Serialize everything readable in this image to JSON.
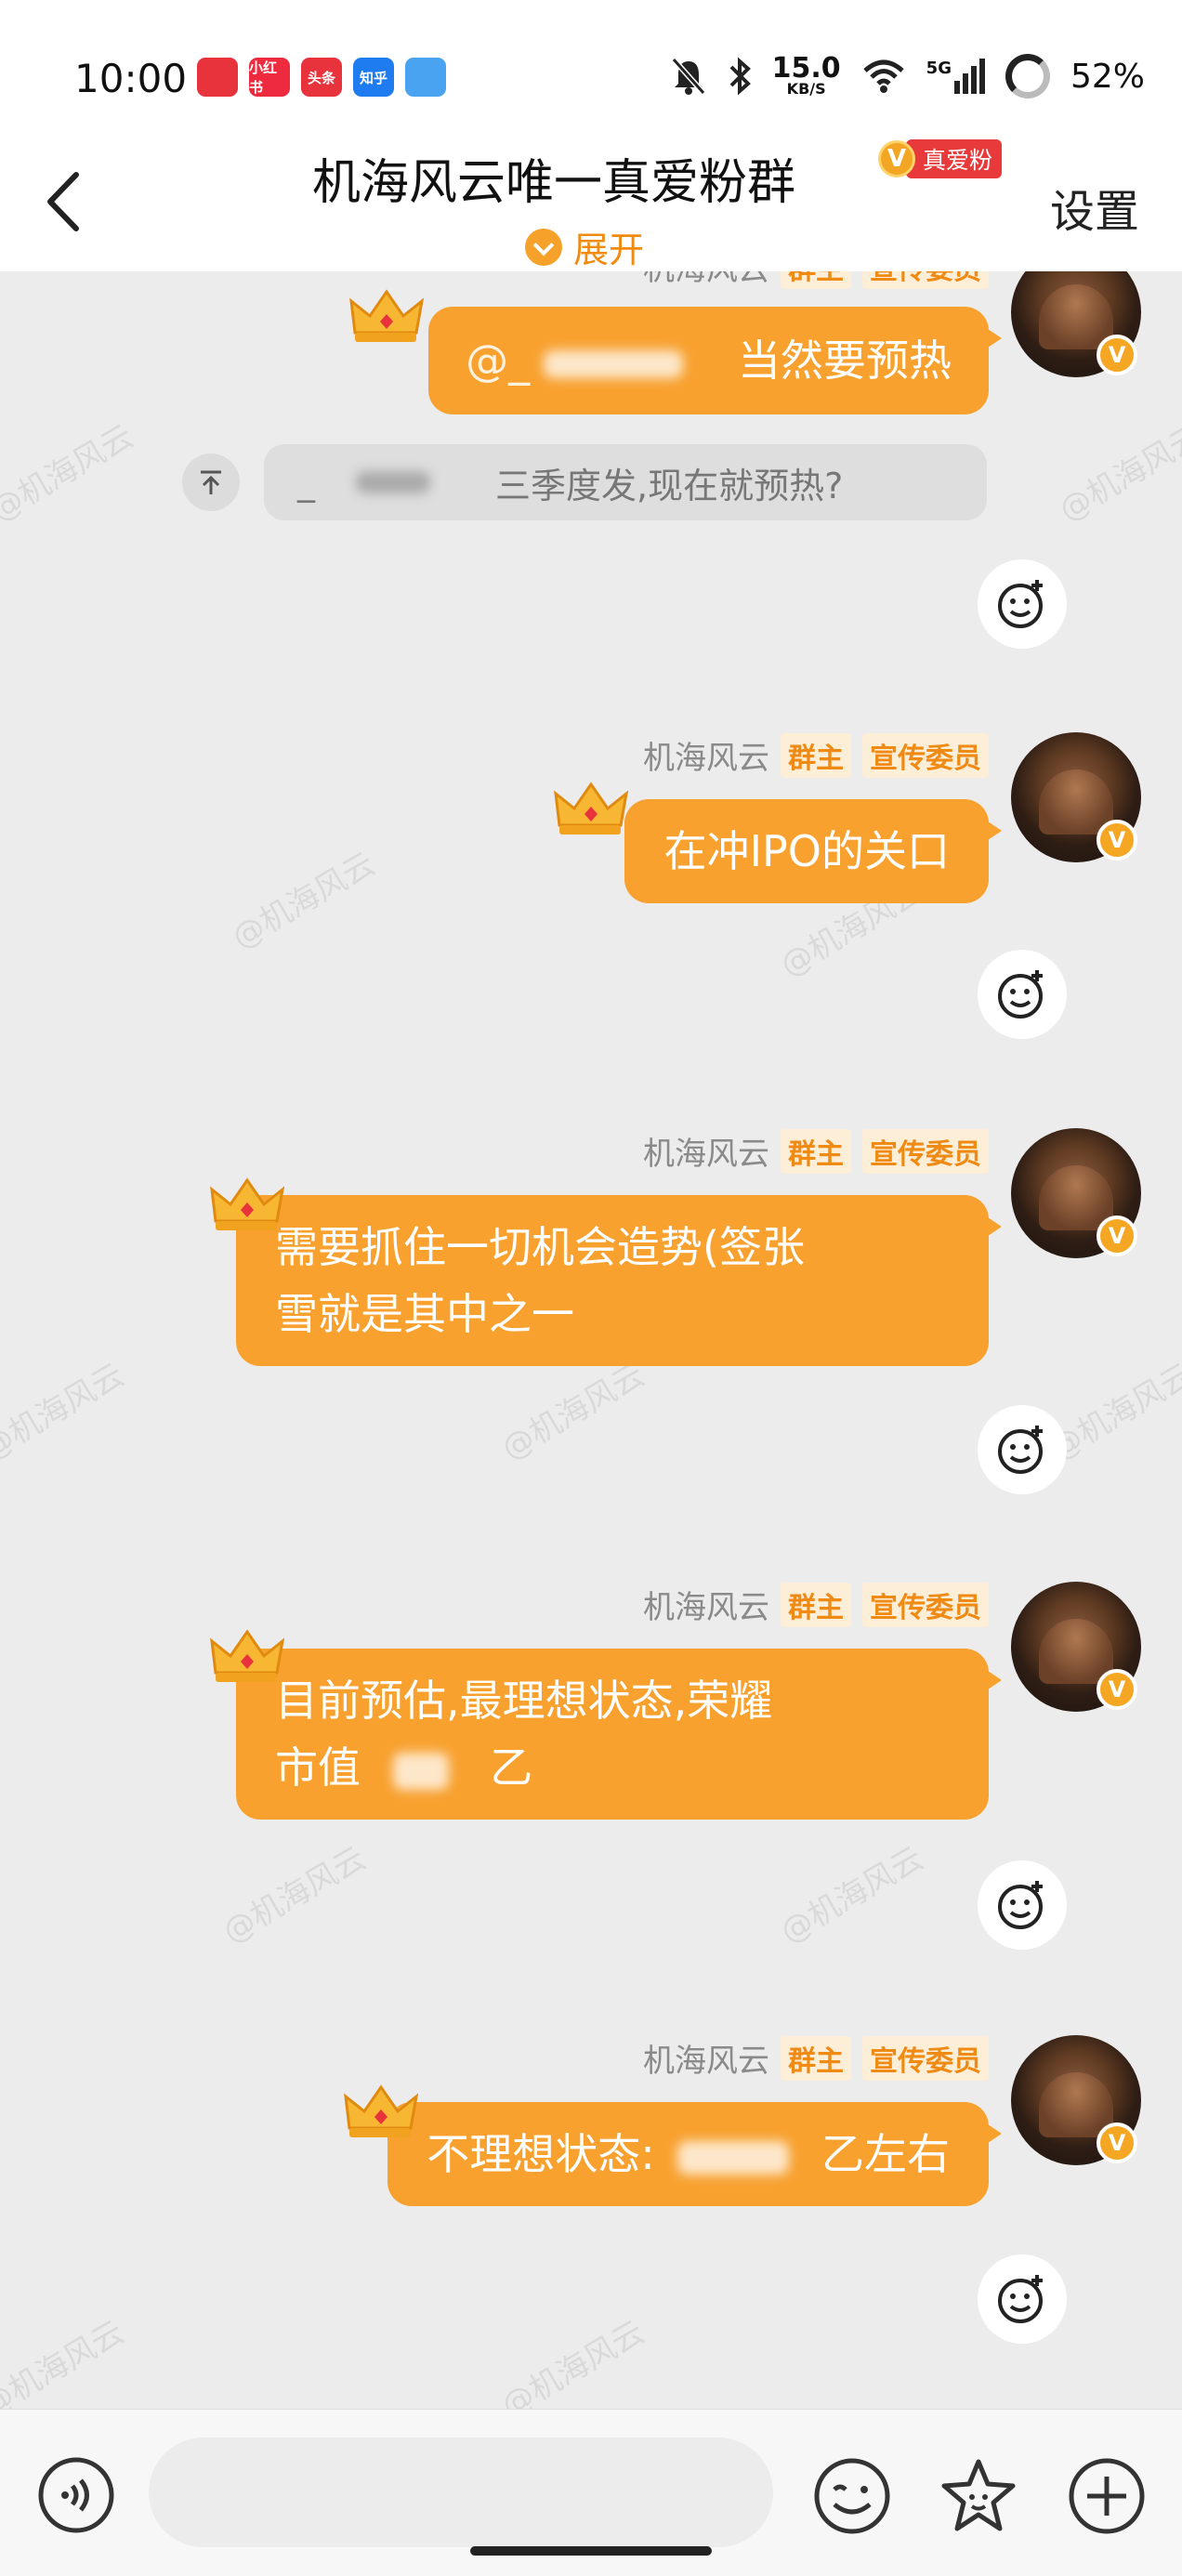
{
  "status_bar": {
    "time": "10:00",
    "app_icons": [
      {
        "label": "",
        "color": "#e8323c"
      },
      {
        "label": "小红书",
        "color": "#ee2a3f"
      },
      {
        "label": "头条",
        "color": "#e8323c"
      },
      {
        "label": "知乎",
        "color": "#1f7bf0"
      },
      {
        "label": "",
        "color": "#4aa3f0"
      }
    ],
    "net_speed_value": "15.0",
    "net_speed_unit": "KB/S",
    "signal": "5G",
    "battery": "52%"
  },
  "header": {
    "title": "机海风云唯一真爱粉群",
    "vip_badge_v": "V",
    "vip_badge_text": "真爱粉",
    "expand_label": "展开",
    "settings_label": "设置"
  },
  "watermark_text": "@机海风云",
  "messages": [
    {
      "sender": "机海风云",
      "owner_tag": "群主",
      "role_tag": "宣传委员",
      "mention_prefix": "@_",
      "text": "当然要预热"
    },
    {
      "sender": "机海风云",
      "owner_tag": "群主",
      "role_tag": "宣传委员",
      "text": "在冲IPO的关口"
    },
    {
      "sender": "机海风云",
      "owner_tag": "群主",
      "role_tag": "宣传委员",
      "line1": "需要抓住一切机会造势(签张",
      "line2": "雪就是其中之一"
    },
    {
      "sender": "机海风云",
      "owner_tag": "群主",
      "role_tag": "宣传委员",
      "line1": "目前预估,最理想状态,荣耀",
      "line2_prefix": "市值",
      "line2_suffix": "乙"
    },
    {
      "sender": "机海风云",
      "owner_tag": "群主",
      "role_tag": "宣传委员",
      "prefix": "不理想状态:",
      "suffix": "乙左右"
    }
  ],
  "quote": {
    "prefix": "_",
    "text": "三季度发,现在就预热?"
  },
  "avatar_badge": "V",
  "colors": {
    "bubble": "#f8a12f",
    "tag_text": "#ef8b14",
    "tag_bg": "#fdeed7",
    "expand": "#f08b10",
    "vip_red": "#e83a3a"
  }
}
